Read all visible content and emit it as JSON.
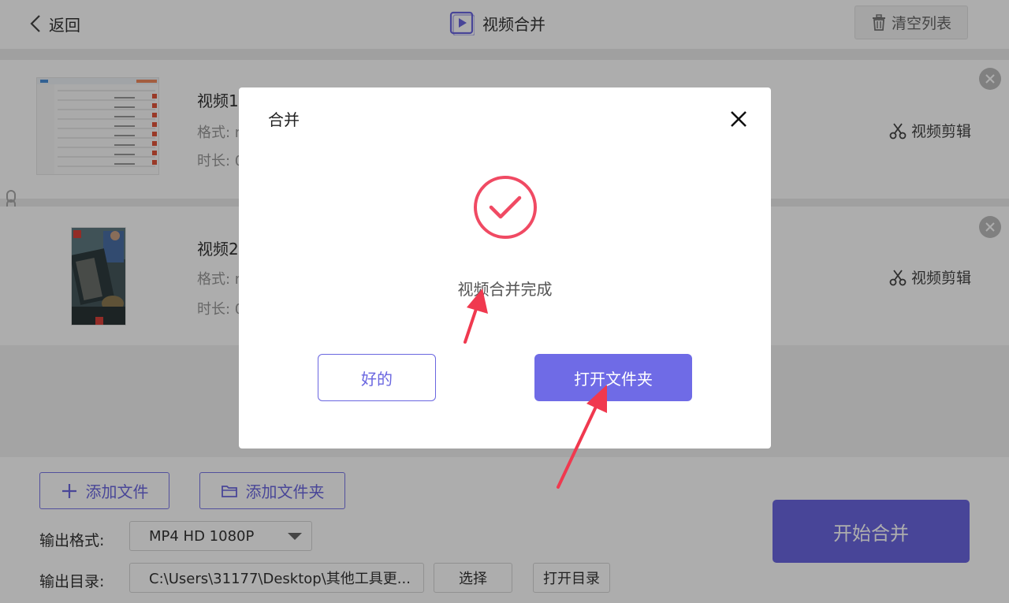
{
  "header": {
    "back_label": "返回",
    "title": "视频合并",
    "clear_label": "清空列表"
  },
  "files": [
    {
      "name": "视频1",
      "format_label": "格式: m",
      "duration_label": "时长: 0",
      "edit_label": "视频剪辑"
    },
    {
      "name": "视频2",
      "format_label": "格式: m",
      "duration_label": "时长: 0",
      "edit_label": "视频剪辑"
    }
  ],
  "bottom": {
    "add_file_label": "添加文件",
    "add_folder_label": "添加文件夹",
    "format_label": "输出格式:",
    "format_value": "MP4 HD 1080P",
    "dir_label": "输出目录:",
    "dir_value": "C:\\Users\\31177\\Desktop\\其他工具更...",
    "choose_label": "选择",
    "open_dir_label": "打开目录",
    "start_label": "开始合并"
  },
  "dialog": {
    "title": "合并",
    "message": "视频合并完成",
    "ok_label": "好的",
    "open_folder_label": "打开文件夹"
  },
  "colors": {
    "accent": "#6a66e0",
    "success": "#f04a63",
    "annotation_arrow": "#f0394f"
  },
  "icons": {
    "back": "chevron-left-icon",
    "title": "video-play-icon",
    "clear": "trash-icon",
    "edit": "scissors-icon",
    "remove": "close-circle-icon",
    "link": "chain-link-icon",
    "add_file": "plus-icon",
    "add_folder": "folder-icon",
    "dialog_close": "close-icon",
    "success": "check-circle-icon"
  }
}
